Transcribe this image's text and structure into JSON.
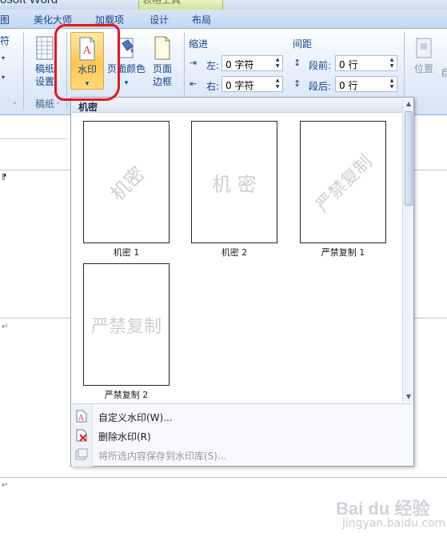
{
  "window": {
    "title": "osoft Word",
    "context_tab_group": "表格工具"
  },
  "tabs": [
    "图",
    "美化大师",
    "加载项",
    "设计",
    "布局"
  ],
  "ribbon": {
    "partial_left_label": "符",
    "manuscript": {
      "button_label_line1": "稿纸",
      "button_label_line2": "设置",
      "group_label": "稿纸"
    },
    "watermark": {
      "line1": "水印",
      "dropdown": "▾"
    },
    "page_color": {
      "line1": "页面颜色",
      "dropdown": "▾"
    },
    "page_border": {
      "line1": "页面",
      "line2": "边框"
    },
    "indent": {
      "group_label": "缩进",
      "left_label": "左:",
      "left_value": "0 字符",
      "right_label": "右:",
      "right_value": "0 字符"
    },
    "spacing": {
      "group_label": "间距",
      "before_label": "段前:",
      "before_value": "0 行",
      "after_label": "段后:",
      "after_value": "0 行"
    },
    "position": {
      "label": "位置"
    },
    "partial_right_label": "自"
  },
  "gallery": {
    "header": "机密",
    "items": [
      {
        "watermark_text": "机密",
        "caption": "机密 1",
        "style": "diagonal"
      },
      {
        "watermark_text": "机 密",
        "caption": "机密 2",
        "style": "horizontal"
      },
      {
        "watermark_text": "严禁复制",
        "caption": "严禁复制 1",
        "style": "diagonal"
      },
      {
        "watermark_text": "严禁复制",
        "caption": "严禁复制 2",
        "style": "horizontal"
      }
    ],
    "menu": [
      {
        "label": "自定义水印(W)...",
        "icon": "custom-watermark-icon",
        "enabled": true
      },
      {
        "label": "删除水印(R)",
        "icon": "remove-watermark-icon",
        "enabled": true
      },
      {
        "label": "将所选内容保存到水印库(S)...",
        "icon": "save-to-gallery-icon",
        "enabled": false
      }
    ]
  },
  "watermark_site": {
    "logo": "Bai du 经验",
    "url": "jingyan.baidu.com"
  },
  "colors": {
    "highlight": "#e8141c",
    "ribbon_text": "#15428b",
    "watermark_gray": "#cfcfcf"
  }
}
